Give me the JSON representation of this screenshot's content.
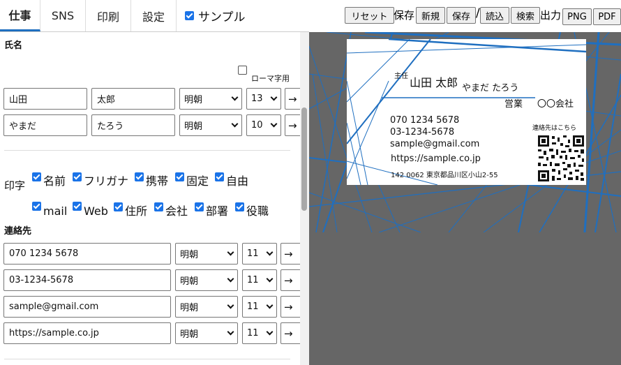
{
  "tabs": [
    {
      "label": "仕事"
    },
    {
      "label": "SNS"
    },
    {
      "label": "印刷"
    },
    {
      "label": "設定"
    }
  ],
  "sample_toggle": {
    "label": "サンプル",
    "checked": true
  },
  "toolbar": {
    "reset": "リセット",
    "save_group": "保存",
    "new": "新規",
    "save": "保存",
    "slash": "/",
    "load": "読込",
    "search": "検索",
    "export_group": "出力",
    "png": "PNG",
    "pdf": "PDF"
  },
  "name_section": {
    "title": "氏名",
    "romaji_label": "ローマ字用",
    "rows": [
      {
        "family": "山田",
        "given": "太郎",
        "font": "明朝",
        "size": "13",
        "arrow": "→"
      },
      {
        "family": "やまだ",
        "given": "たろう",
        "font": "明朝",
        "size": "10",
        "arrow": "→"
      }
    ]
  },
  "print_options": {
    "label": "印字",
    "items": [
      "名前",
      "フリガナ",
      "携帯",
      "固定",
      "自由",
      "mail",
      "Web",
      "住所",
      "会社",
      "部署",
      "役職"
    ]
  },
  "contact_section": {
    "title": "連絡先",
    "rows": [
      {
        "value": "070 1234 5678",
        "font": "明朝",
        "size": "11",
        "arrow": "→"
      },
      {
        "value": "03-1234-5678",
        "font": "明朝",
        "size": "11",
        "arrow": "→"
      },
      {
        "value": "sample@gmail.com",
        "font": "明朝",
        "size": "11",
        "arrow": "→"
      },
      {
        "value": "https://sample.co.jp",
        "font": "明朝",
        "size": "11",
        "arrow": "→"
      }
    ]
  },
  "card": {
    "title_role": "主任",
    "name": "山田 太郎",
    "furigana": "やまだ たろう",
    "dept": "営業",
    "company": "〇〇会社",
    "mobile": "070 1234 5678",
    "phone": "03-1234-5678",
    "email": "sample@gmail.com",
    "web": "https://sample.co.jp",
    "address": "142 0062 東京都品川区小山2-55",
    "qr_caption": "連絡先はこちら",
    "accent_color": "#1f6fc0"
  },
  "colors": {
    "accent": "#1a73e8",
    "preview_bg": "#666666"
  }
}
